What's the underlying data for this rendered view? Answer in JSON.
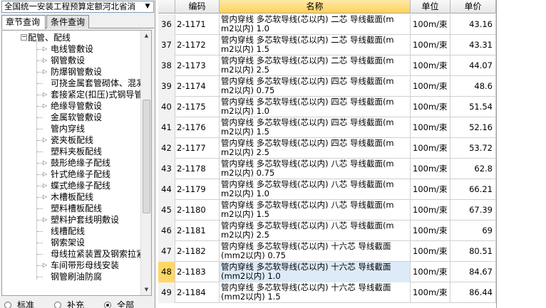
{
  "library": {
    "selected": "全国统一安装工程预算定额河北省消"
  },
  "tabs": [
    {
      "label": "章节查询",
      "active": true
    },
    {
      "label": "条件查询",
      "active": false
    }
  ],
  "tree": {
    "root": {
      "label": "配管、配线",
      "expanded": true
    },
    "items": [
      {
        "label": "电线管敷设",
        "has_children": true
      },
      {
        "label": "钢管敷设",
        "has_children": true
      },
      {
        "label": "防爆钢管敷设",
        "has_children": true
      },
      {
        "label": "可挠金属套管砌体、混凝",
        "has_children": false
      },
      {
        "label": "套接紧定(扣压)式钢导管",
        "has_children": true
      },
      {
        "label": "绝缘导管敷设",
        "has_children": true
      },
      {
        "label": "金属软管敷设",
        "has_children": false
      },
      {
        "label": "管内穿线",
        "has_children": false
      },
      {
        "label": "瓷夹板配线",
        "has_children": true
      },
      {
        "label": "塑料夹板配线",
        "has_children": false
      },
      {
        "label": "鼓形绝缘子配线",
        "has_children": true
      },
      {
        "label": "针式绝缘子配线",
        "has_children": true
      },
      {
        "label": "蝶式绝缘子配线",
        "has_children": true
      },
      {
        "label": "木槽板配线",
        "has_children": true
      },
      {
        "label": "塑料槽板配线",
        "has_children": false
      },
      {
        "label": "塑料护套线明敷设",
        "has_children": true
      },
      {
        "label": "线槽配线",
        "has_children": false
      },
      {
        "label": "钢索架设",
        "has_children": false
      },
      {
        "label": "母线拉紧装置及钢索拉紧",
        "has_children": false
      },
      {
        "label": "车间带形母线安装",
        "has_children": true
      },
      {
        "label": "钢管刷油防腐",
        "has_children": false
      }
    ]
  },
  "filter": {
    "options": [
      {
        "label": "标准",
        "checked": false
      },
      {
        "label": "补充",
        "checked": false
      },
      {
        "label": "全部",
        "checked": true
      }
    ]
  },
  "table": {
    "columns": [
      "编码",
      "名称",
      "单位",
      "单价"
    ],
    "rows": [
      {
        "no": "36",
        "code": "2-1171",
        "name1": "管内穿线 多芯软导线(芯以内) 二芯 导线截面(m",
        "name2": "m2以内) 1.0",
        "unit": "100m/束",
        "price": "43.16"
      },
      {
        "no": "37",
        "code": "2-1172",
        "name1": "管内穿线 多芯软导线(芯以内) 二芯 导线截面(m",
        "name2": "m2以内) 1.5",
        "unit": "100m/束",
        "price": "43.31"
      },
      {
        "no": "38",
        "code": "2-1173",
        "name1": "管内穿线 多芯软导线(芯以内) 二芯 导线截面(m",
        "name2": "m2以内) 2.5",
        "unit": "100m/束",
        "price": "44.07"
      },
      {
        "no": "39",
        "code": "2-1174",
        "name1": "管内穿线 多芯软导线(芯以内) 四芯 导线截面(m",
        "name2": "m2以内) 0.75",
        "unit": "100m/束",
        "price": "48.6"
      },
      {
        "no": "40",
        "code": "2-1175",
        "name1": "管内穿线 多芯软导线(芯以内) 四芯 导线截面(m",
        "name2": "m2以内) 1.0",
        "unit": "100m/束",
        "price": "51.54"
      },
      {
        "no": "41",
        "code": "2-1176",
        "name1": "管内穿线 多芯软导线(芯以内) 四芯 导线截面(m",
        "name2": "m2以内) 1.5",
        "unit": "100m/束",
        "price": "52.16"
      },
      {
        "no": "42",
        "code": "2-1177",
        "name1": "管内穿线 多芯软导线(芯以内) 四芯 导线截面(m",
        "name2": "m2以内) 2.5",
        "unit": "100m/束",
        "price": "53.72"
      },
      {
        "no": "43",
        "code": "2-1178",
        "name1": "管内穿线 多芯软导线(芯以内) 八芯 导线截面(m",
        "name2": "m2以内) 0.75",
        "unit": "100m/束",
        "price": "62.8"
      },
      {
        "no": "44",
        "code": "2-1179",
        "name1": "管内穿线 多芯软导线(芯以内) 八芯 导线截面(m",
        "name2": "m2以内) 1.0",
        "unit": "100m/束",
        "price": "66.21"
      },
      {
        "no": "45",
        "code": "2-1180",
        "name1": "管内穿线 多芯软导线(芯以内) 八芯 导线截面(m",
        "name2": "m2以内) 1.5",
        "unit": "100m/束",
        "price": "67.39"
      },
      {
        "no": "46",
        "code": "2-1181",
        "name1": "管内穿线 多芯软导线(芯以内) 八芯 导线截面(m",
        "name2": "m2以内) 2.5",
        "unit": "100m/束",
        "price": "69"
      },
      {
        "no": "47",
        "code": "2-1182",
        "name1": "管内穿线 多芯软导线(芯以内) 十六芯 导线截面",
        "name2": "(mm2以内) 0.75",
        "unit": "100m/束",
        "price": "80.51"
      },
      {
        "no": "48",
        "code": "2-1183",
        "name1": "管内穿线 多芯软导线(芯以内) 十六芯 导线截面",
        "name2": "(mm2以内) 1.0",
        "unit": "100m/束",
        "price": "84.67",
        "selected": true
      },
      {
        "no": "49",
        "code": "2-1184",
        "name1": "管内穿线 多芯软导线(芯以内) 十六芯 导线截面",
        "name2": "(mm2以内) 1.5",
        "unit": "100m/束",
        "price": "86.44"
      }
    ]
  },
  "colors": {
    "header_selected": "#ffd15c",
    "row_selected_no": "#ffd766",
    "row_selected_bg": "#ddeaf8"
  }
}
